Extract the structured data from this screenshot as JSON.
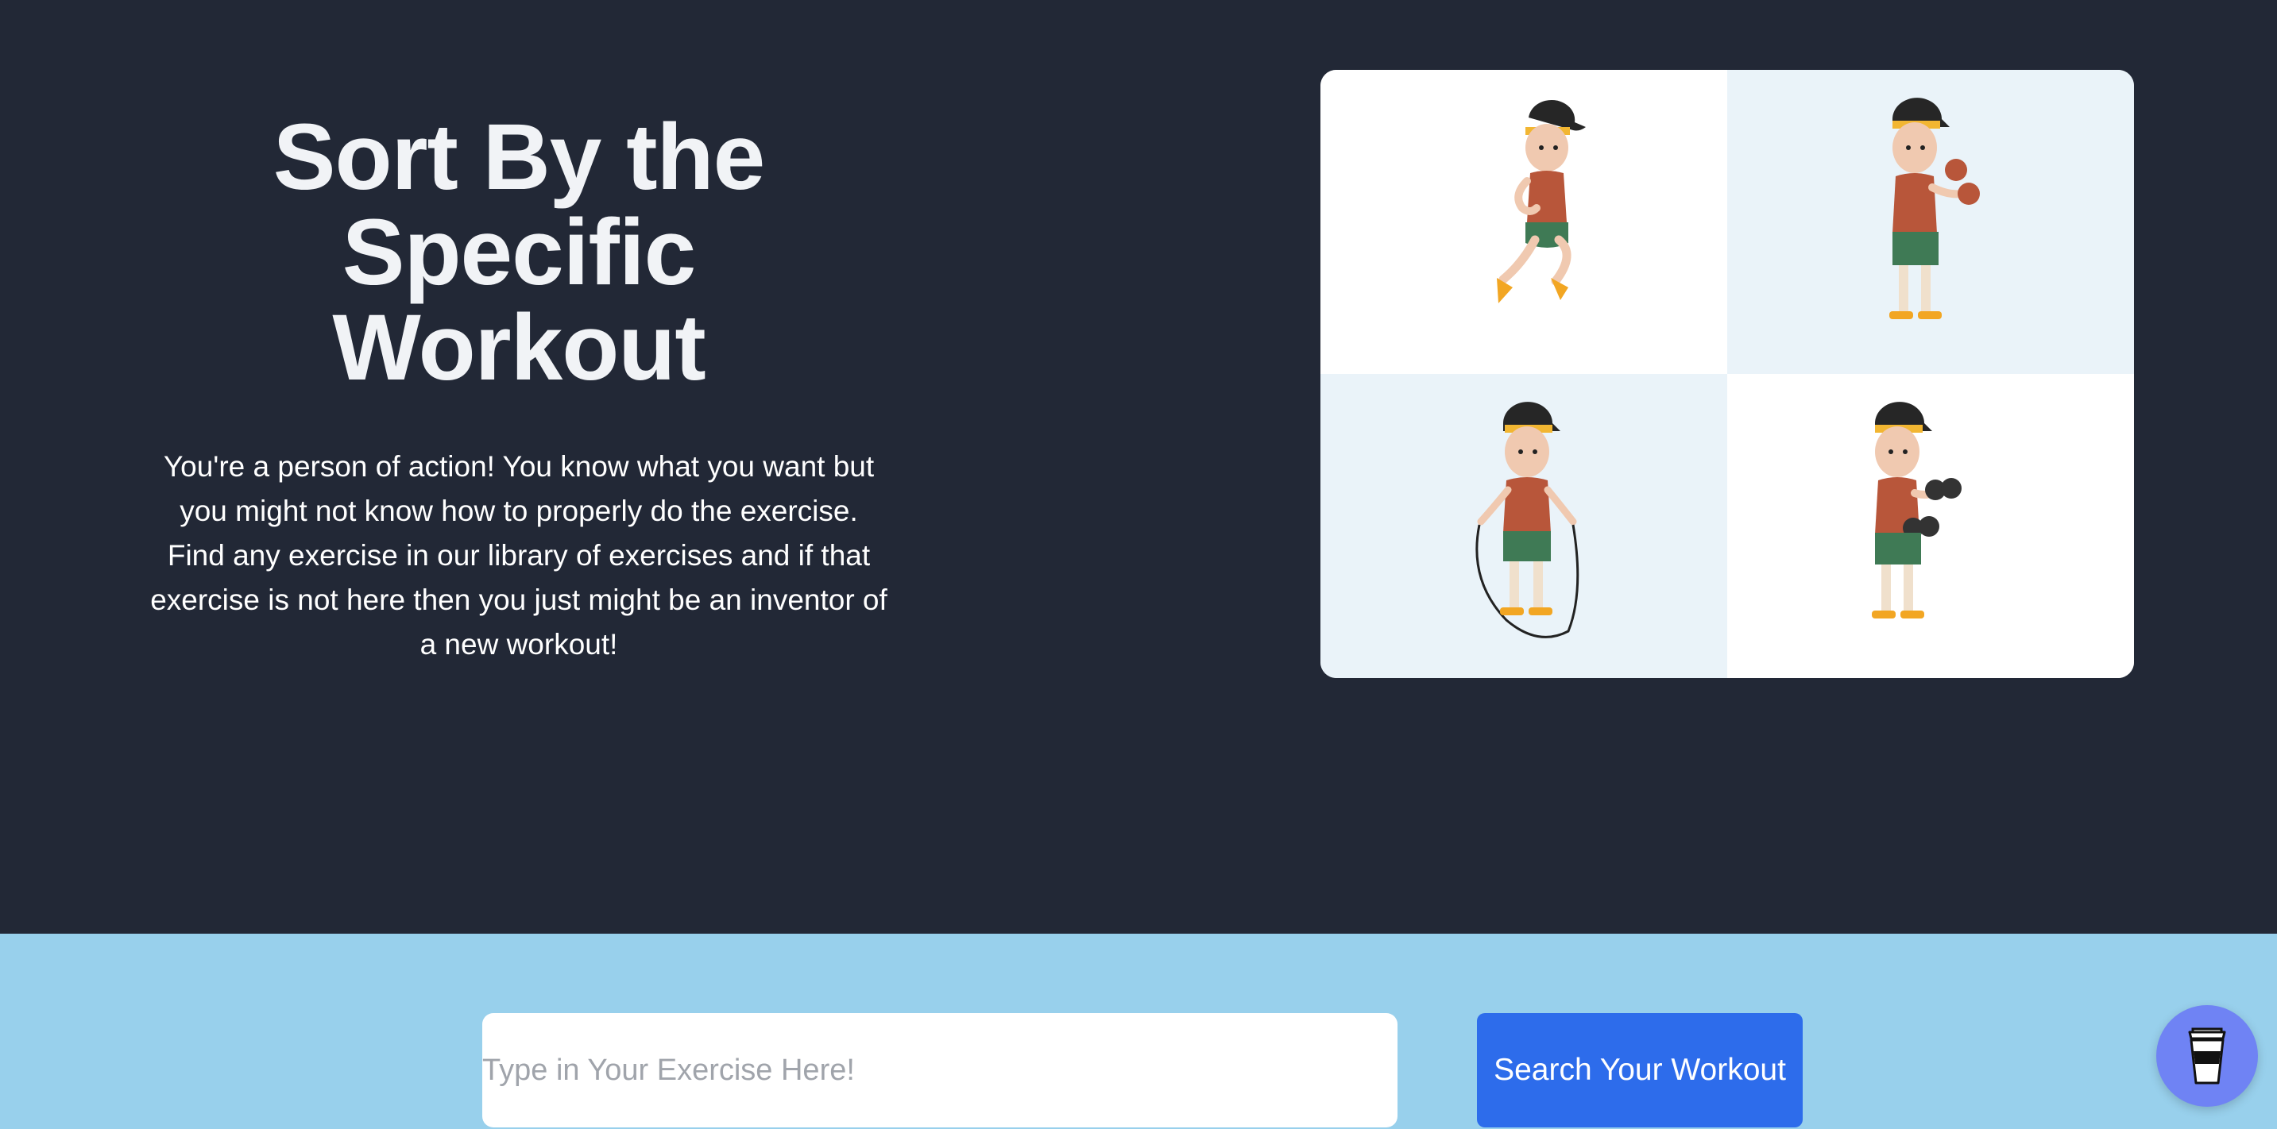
{
  "hero": {
    "title": "Sort By the\nSpecific\nWorkout",
    "description": "You're a person of action! You know what you want but you might not know how to properly do the exercise. Find any exercise in our library of exercises and if that exercise is not here then you just might be an inventor of a new workout!"
  },
  "illustrations": [
    {
      "name": "running",
      "icon": "running-man-illustration"
    },
    {
      "name": "boxing",
      "icon": "boxing-man-illustration"
    },
    {
      "name": "jump-rope",
      "icon": "jump-rope-man-illustration"
    },
    {
      "name": "dumbbells",
      "icon": "dumbbell-man-illustration"
    }
  ],
  "search": {
    "placeholder": "Type in Your Exercise Here!",
    "button_label": "Search Your Workout"
  },
  "colors": {
    "hero_background": "#222836",
    "band_background": "#98d0ec",
    "button": "#2d6ceb",
    "coffee_button": "#6f83f4"
  },
  "coffee_button": {
    "icon": "coffee-cup-icon"
  }
}
